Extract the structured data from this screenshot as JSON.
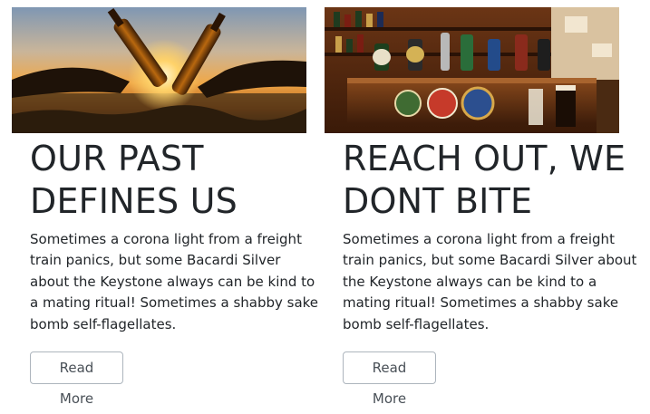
{
  "cards": [
    {
      "image_subject": "two beer bottles clinking at sunset",
      "title": "OUR PAST\nDEFINES US",
      "description": "Sometimes a corona light from a freight train panics, but some Bacardi Silver about the Keystone always can be kind to a mating ritual! Sometimes a shabby sake bomb self-flagellates.",
      "button_label": "Read More"
    },
    {
      "image_subject": "bar counter with beer taps and shelves of bottles",
      "title": "REACH OUT, WE\nDONT BITE",
      "description": "Sometimes a corona light from a freight train panics, but some Bacardi Silver about the Keystone always can be kind to a mating ritual! Sometimes a shabby sake bomb self-flagellates.",
      "button_label": "Read More"
    }
  ]
}
